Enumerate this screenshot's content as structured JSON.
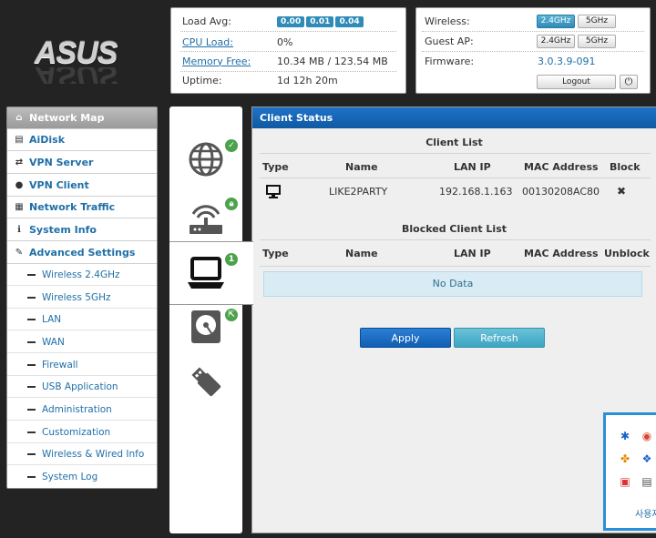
{
  "brand": {
    "logo_text": "ASUS"
  },
  "status": {
    "load_avg_label": "Load Avg:",
    "load_avg_values": [
      "0.00",
      "0.01",
      "0.04"
    ],
    "cpu_label": "CPU Load:",
    "cpu_value": "0%",
    "mem_label": "Memory Free:",
    "mem_value": "10.34 MB / 123.54 MB",
    "uptime_label": "Uptime:",
    "uptime_value": "1d 12h 20m"
  },
  "wireless": {
    "wireless_label": "Wireless:",
    "guest_label": "Guest AP:",
    "firmware_label": "Firmware:",
    "firmware_value": "3.0.3.9-091",
    "band_24": "2.4GHz",
    "band_5": "5GHz",
    "logout_label": "Logout"
  },
  "sidebar": {
    "items": [
      {
        "label": "Network Map",
        "icon": "home-icon"
      },
      {
        "label": "AiDisk",
        "icon": "disk-icon"
      },
      {
        "label": "VPN Server",
        "icon": "vpn-icon"
      },
      {
        "label": "VPN Client",
        "icon": "globe-icon"
      },
      {
        "label": "Network Traffic",
        "icon": "traffic-icon"
      },
      {
        "label": "System Info",
        "icon": "info-icon"
      },
      {
        "label": "Advanced Settings",
        "icon": "wrench-icon"
      }
    ],
    "subitems": [
      "Wireless 2.4GHz",
      "Wireless 5GHz",
      "LAN",
      "WAN",
      "Firewall",
      "USB Application",
      "Administration",
      "Customization",
      "Wireless & Wired Info",
      "System Log"
    ]
  },
  "iconcol": {
    "clients_count": "1"
  },
  "main": {
    "title": "Client Status",
    "client_list_title": "Client List",
    "columns": [
      "Type",
      "Name",
      "LAN IP",
      "MAC Address",
      "Block"
    ],
    "clients": [
      {
        "name": "LIKE2PARTY",
        "ip": "192.168.1.163",
        "mac": "00130208AC80",
        "block": "✖"
      }
    ],
    "blocked_title": "Blocked Client List",
    "blocked_columns": [
      "Type",
      "Name",
      "LAN IP",
      "MAC Address",
      "Unblock"
    ],
    "no_data": "No Data",
    "apply_label": "Apply",
    "refresh_label": "Refresh"
  },
  "tray": {
    "label": "사용자"
  },
  "colors": {
    "accent": "#1e73c8",
    "link": "#1f6fa7",
    "badge": "#2f8bb7",
    "ok": "#4ca34c"
  }
}
